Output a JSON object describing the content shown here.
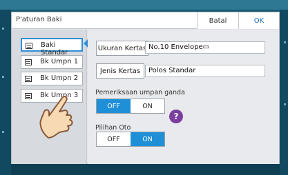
{
  "dialog": {
    "title": "P'aturan Baki",
    "cancel_label": "Batal",
    "ok_label": "OK"
  },
  "sidebar": {
    "items": [
      {
        "label": "Baki Standar",
        "selected": true
      },
      {
        "label": "Bk Umpn 1",
        "selected": false
      },
      {
        "label": "Bk Umpn 2",
        "selected": false
      },
      {
        "label": "Bk Umpn 3",
        "selected": false
      }
    ]
  },
  "settings": {
    "paper_size_label": "Ukuran Kertas",
    "paper_size_value": "No.10 Envelope▭",
    "paper_type_label": "Jenis Kertas",
    "paper_type_value": "Polos Standar",
    "double_feed_label": "Pemeriksaan umpan ganda",
    "double_feed_off": "OFF",
    "double_feed_on": "ON",
    "double_feed_state": "OFF",
    "help_glyph": "?",
    "auto_select_label": "Pilihan Oto",
    "auto_select_off": "OFF",
    "auto_select_on": "ON",
    "auto_select_state": "ON"
  },
  "colors": {
    "accent": "#1f8fd8",
    "help": "#7b3fa0",
    "hand_fill": "#f7d9b3",
    "hand_stroke": "#8a5a3a"
  }
}
